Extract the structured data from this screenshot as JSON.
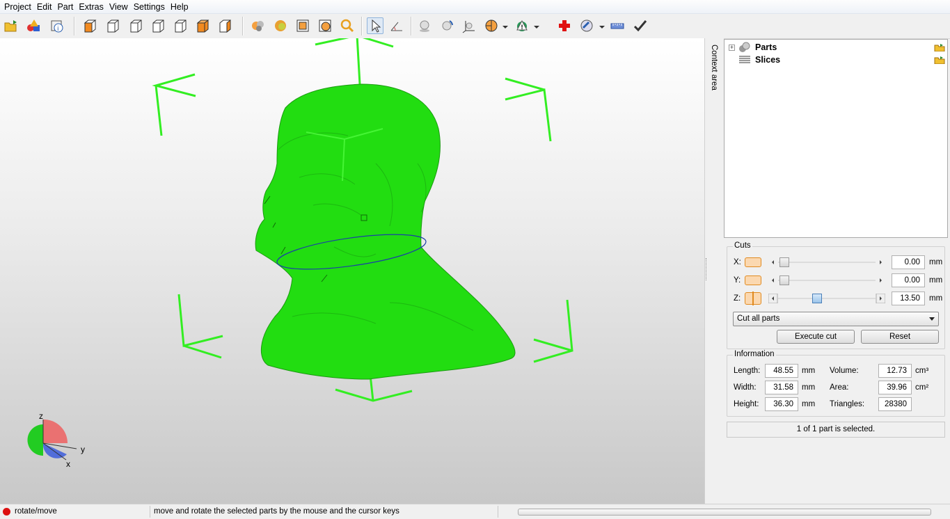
{
  "menu": [
    "Project",
    "Edit",
    "Part",
    "Extras",
    "View",
    "Settings",
    "Help"
  ],
  "toolbar": {
    "icons": [
      "open-folder-icon",
      "add-shapes-icon",
      "part-info-icon",
      "view-front-icon",
      "view-back-icon",
      "view-left-icon",
      "view-right-icon",
      "view-top-icon",
      "view-bottom-icon",
      "view-iso-icon",
      "shaded-icon",
      "textured-icon",
      "wireframe-icon",
      "mixed-view-icon",
      "zoom-icon",
      "select-cursor-icon",
      "measure-angle-icon",
      "sphere-icon",
      "rotate-sphere-icon",
      "axes-icon",
      "section-icon",
      "repair-icon",
      "red-cross-icon",
      "tools-icon",
      "ruler-icon",
      "checkmark-icon"
    ]
  },
  "context_area": {
    "label": "Context area"
  },
  "tree": {
    "items": [
      {
        "label": "Parts"
      },
      {
        "label": "Slices"
      }
    ]
  },
  "cuts": {
    "title": "Cuts",
    "x_label": "X:",
    "x_value": "0.00",
    "x_pos": 0.0,
    "y_label": "Y:",
    "y_value": "0.00",
    "y_pos": 0.0,
    "z_label": "Z:",
    "z_value": "13.50",
    "z_pos": 0.38,
    "unit": "mm",
    "mode": "Cut all parts",
    "execute_label": "Execute cut",
    "reset_label": "Reset"
  },
  "information": {
    "title": "Information",
    "length_label": "Length:",
    "length_value": "48.55",
    "length_unit": "mm",
    "width_label": "Width:",
    "width_value": "31.58",
    "width_unit": "mm",
    "height_label": "Height:",
    "height_value": "36.30",
    "height_unit": "mm",
    "volume_label": "Volume:",
    "volume_value": "12.73",
    "volume_unit": "cm³",
    "area_label": "Area:",
    "area_value": "39.96",
    "area_unit": "cm²",
    "triangles_label": "Triangles:",
    "triangles_value": "28380"
  },
  "selection_status": "1 of 1 part is selected.",
  "axes": {
    "z": "z",
    "y": "y",
    "x": "x"
  },
  "status": {
    "mode": "rotate/move",
    "hint": "move and rotate the selected parts by the mouse and the cursor keys"
  },
  "colors": {
    "model": "#22dd11",
    "bracket": "#33ee22",
    "cut_line": "#1a3fa8",
    "status_dot": "#dd1111",
    "accent_orange": "#f0a030"
  }
}
